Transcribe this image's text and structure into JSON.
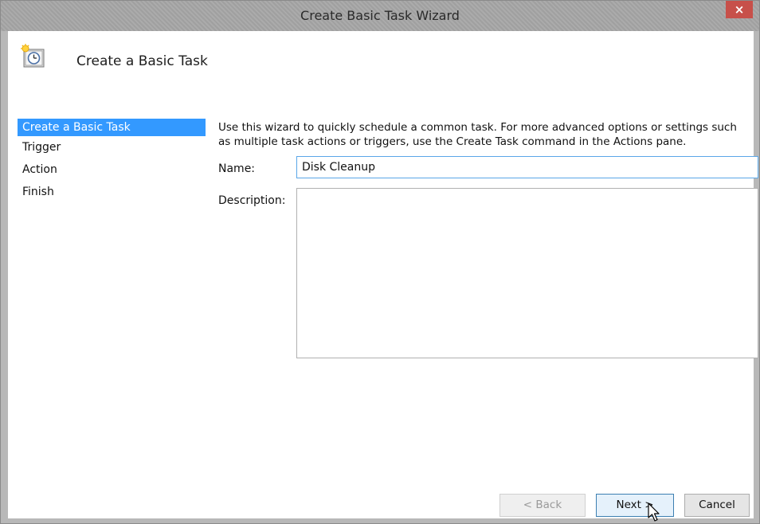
{
  "window": {
    "title": "Create Basic Task Wizard",
    "close_glyph": "×"
  },
  "header": {
    "title": "Create a Basic Task",
    "icon": "scheduled-task-clock-icon"
  },
  "steps": [
    {
      "label": "Create a Basic Task",
      "active": true
    },
    {
      "label": "Trigger",
      "active": false
    },
    {
      "label": "Action",
      "active": false
    },
    {
      "label": "Finish",
      "active": false
    }
  ],
  "content": {
    "intro": "Use this wizard to quickly schedule a common task.  For more advanced options or settings such as multiple task actions or triggers, use the Create Task command in the Actions pane.",
    "name_label": "Name:",
    "name_value": "Disk Cleanup",
    "description_label": "Description:",
    "description_value": ""
  },
  "buttons": {
    "back": "< Back",
    "next": "Next >",
    "cancel": "Cancel"
  },
  "colors": {
    "selection": "#3399ff",
    "close": "#c7504a",
    "focus_border": "#5aa7e8"
  }
}
